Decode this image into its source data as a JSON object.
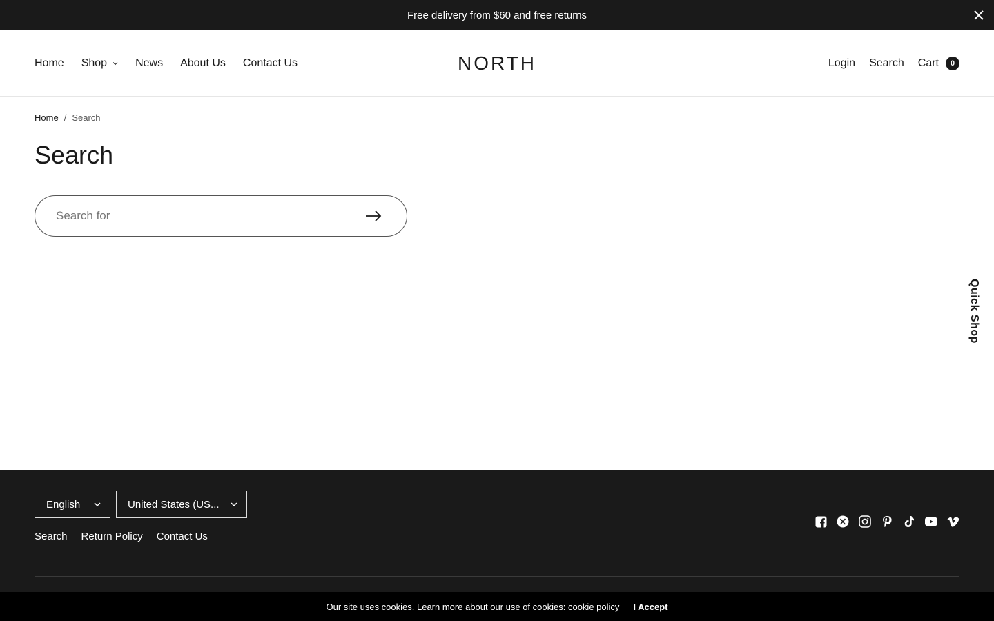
{
  "announcement": {
    "text": "Free delivery from $60 and free returns"
  },
  "header": {
    "logo": "NORTH",
    "nav": [
      {
        "label": "Home"
      },
      {
        "label": "Shop"
      },
      {
        "label": "News"
      },
      {
        "label": "About Us"
      },
      {
        "label": "Contact Us"
      }
    ],
    "right": {
      "login": "Login",
      "search": "Search",
      "cart": "Cart",
      "cart_count": "0"
    }
  },
  "breadcrumb": {
    "home": "Home",
    "separator": "/",
    "current": "Search"
  },
  "page": {
    "title": "Search",
    "search_placeholder": "Search for",
    "search_value": ""
  },
  "quick_shop": "Quick Shop",
  "footer": {
    "language": "English",
    "country": "United States (US...",
    "links": [
      "Search",
      "Return Policy",
      "Contact Us"
    ],
    "socials": [
      "facebook-icon",
      "x-icon",
      "instagram-icon",
      "pinterest-icon",
      "tiktok-icon",
      "youtube-icon",
      "vimeo-icon"
    ]
  },
  "cookie": {
    "text": "Our site uses cookies. Learn more about our use of cookies:",
    "policy_link": "cookie policy",
    "accept": "I Accept"
  },
  "colors": {
    "dark": "#1a1a1a",
    "cookie_bg": "#000000",
    "text": "#1a1a1a"
  }
}
